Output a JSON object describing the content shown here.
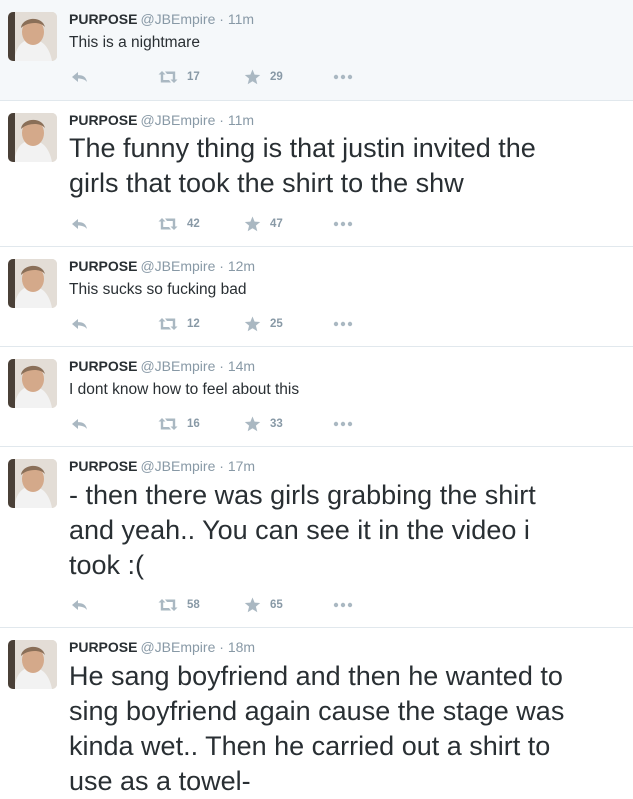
{
  "tweets": [
    {
      "name": "PURPOSE",
      "handle": "@JBEmpire",
      "time": "11m",
      "text_lines": [
        "This is a nightmare"
      ],
      "retweets": "17",
      "favorites": "29"
    },
    {
      "name": "PURPOSE",
      "handle": "@JBEmpire",
      "time": "11m",
      "text_lines": [
        "The funny thing is that justin invited the",
        "girls that took the shirt to the shw"
      ],
      "retweets": "42",
      "favorites": "47"
    },
    {
      "name": "PURPOSE",
      "handle": "@JBEmpire",
      "time": "12m",
      "text_lines": [
        "This sucks so fucking bad"
      ],
      "retweets": "12",
      "favorites": "25"
    },
    {
      "name": "PURPOSE",
      "handle": "@JBEmpire",
      "time": "14m",
      "text_lines": [
        "I dont know how to feel about this"
      ],
      "retweets": "16",
      "favorites": "33"
    },
    {
      "name": "PURPOSE",
      "handle": "@JBEmpire",
      "time": "17m",
      "text_lines": [
        "- then there was girls grabbing the shirt",
        "and yeah.. You can see it in the video i",
        "took :("
      ],
      "retweets": "58",
      "favorites": "65"
    },
    {
      "name": "PURPOSE",
      "handle": "@JBEmpire",
      "time": "18m",
      "text_lines": [
        "He sang boyfriend and then he wanted to",
        "sing boyfriend again cause the stage was",
        "kinda wet.. Then he carried out a shirt to",
        "use as a towel-"
      ]
    }
  ],
  "separator": "·",
  "icons": {
    "reply": "reply-icon",
    "retweet": "retweet-icon",
    "favorite": "star-icon",
    "more": "more-icon"
  },
  "colors": {
    "muted": "#8899a6",
    "text": "#292f33",
    "divider": "#e1e8ed",
    "highlight_bg": "#f5f8fa"
  }
}
